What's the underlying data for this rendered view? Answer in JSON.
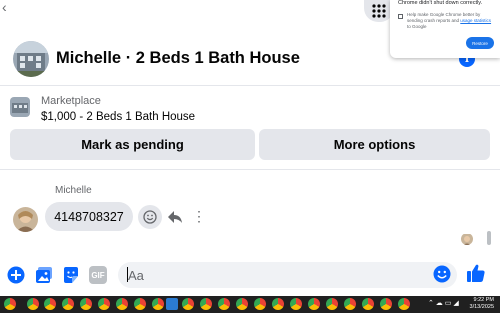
{
  "header": {
    "title": "Michelle · 2 Beds 1 Bath House"
  },
  "listing": {
    "category": "Marketplace",
    "price_title": "$1,000 - 2 Beds 1 Bath House",
    "mark_pending_label": "Mark as pending",
    "more_options_label": "More options"
  },
  "conversation": {
    "sender_name": "Michelle",
    "message_text": "4148708327"
  },
  "composer": {
    "placeholder": "Aa",
    "gif_label": "GIF"
  },
  "chrome_popup": {
    "title": "Chrome didn't shut down correctly.",
    "checkbox_text": "Help make Google Chrome better by sending crash reports and",
    "link_text": "usage statistics",
    "checkbox_suffix": "to Google",
    "restore_label": "Restore"
  },
  "taskbar": {
    "time": "9:22 PM",
    "date": "3/13/2025"
  },
  "colors": {
    "accent": "#0866ff",
    "bubble": "#e4e6eb",
    "taskbar": "#202020"
  }
}
